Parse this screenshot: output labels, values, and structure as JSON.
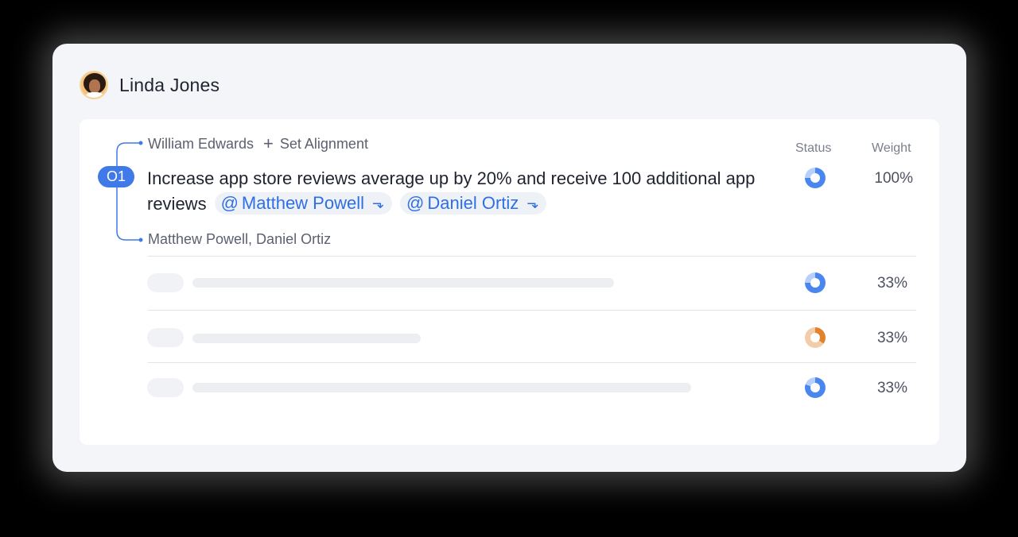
{
  "user": {
    "name": "Linda Jones"
  },
  "objective": {
    "badge": "O1",
    "aligned_to": "William Edwards",
    "set_alignment_label": "Set Alignment",
    "text": "Increase app store reviews average up by 20% and receive 100 additional app reviews",
    "mentions": [
      {
        "name": "Matthew Powell"
      },
      {
        "name": "Daniel Ortiz"
      }
    ],
    "owners": "Matthew Powell, Daniel Ortiz",
    "status_progress": 0.75,
    "weight": "100%"
  },
  "columns": {
    "status": "Status",
    "weight": "Weight"
  },
  "key_results": [
    {
      "weight": "33%",
      "status_color": "#4a86f0",
      "status_progress": 0.75
    },
    {
      "weight": "33%",
      "status_color": "#e2822a",
      "status_progress": 0.35
    },
    {
      "weight": "33%",
      "status_color": "#4a86f0",
      "status_progress": 0.8
    }
  ],
  "colors": {
    "accent": "#3f7ae8",
    "mention_text": "#2f6fe6",
    "status_blue": "#4a86f0",
    "status_orange": "#e2822a"
  }
}
